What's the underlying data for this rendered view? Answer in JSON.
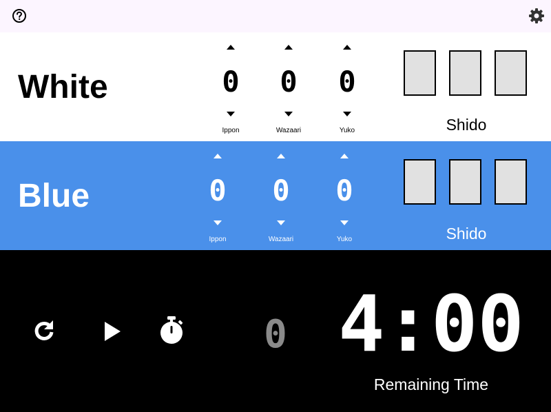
{
  "toolbar": {
    "help_icon": "help-circle-icon",
    "settings_icon": "gear-icon"
  },
  "white": {
    "name": "White",
    "scores": [
      {
        "label": "Ippon",
        "value": "0"
      },
      {
        "label": "Wazaari",
        "value": "0"
      },
      {
        "label": "Yuko",
        "value": "0"
      }
    ],
    "shido_label": "Shido",
    "background": "#ffffff",
    "text_color": "#000000"
  },
  "blue": {
    "name": "Blue",
    "scores": [
      {
        "label": "Ippon",
        "value": "0"
      },
      {
        "label": "Wazaari",
        "value": "0"
      },
      {
        "label": "Yuko",
        "value": "0"
      }
    ],
    "shido_label": "Shido",
    "background": "#4a90ea",
    "text_color": "#ffffff"
  },
  "controls": {
    "reset_icon": "reset-icon",
    "play_icon": "play-icon",
    "stopwatch_icon": "stopwatch-icon"
  },
  "osaekomi": {
    "value": "0",
    "color": "#8a8a8a"
  },
  "timer": {
    "value": "4:00",
    "label": "Remaining Time"
  },
  "colors": {
    "topbar": "#fcf5ff",
    "shido_box": "#e1e1e1",
    "bottom": "#000000"
  }
}
